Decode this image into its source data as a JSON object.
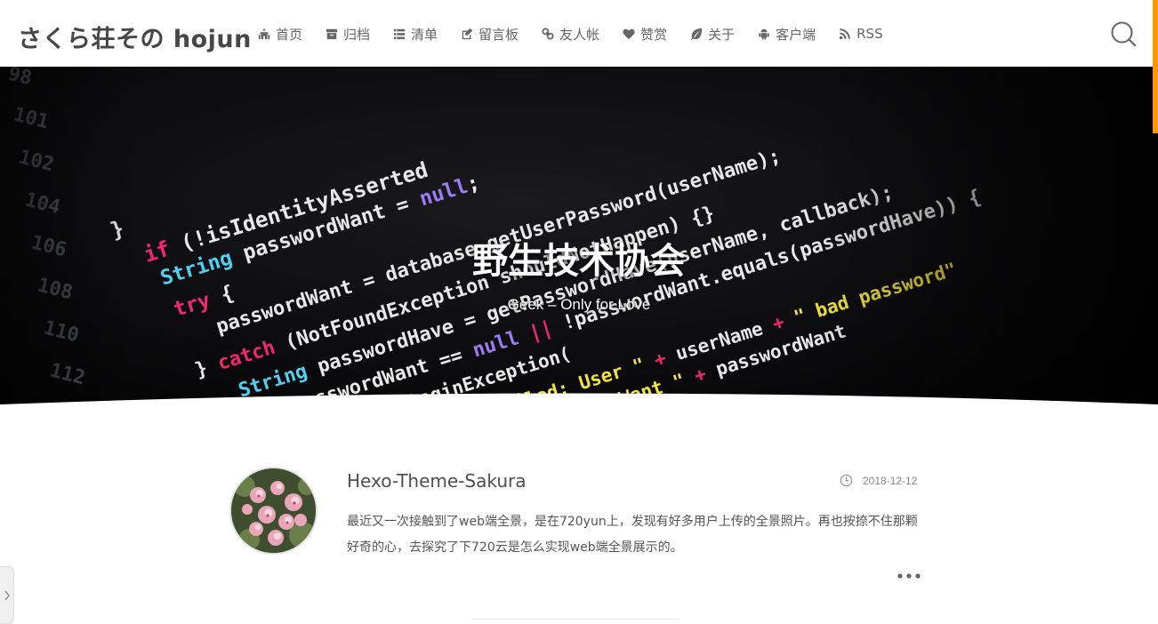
{
  "header": {
    "site_title": "さくら荘その hojun",
    "nav": [
      {
        "label": "首页",
        "icon": "home-icon"
      },
      {
        "label": "归档",
        "icon": "archive-icon"
      },
      {
        "label": "清单",
        "icon": "list-icon"
      },
      {
        "label": "留言板",
        "icon": "edit-icon"
      },
      {
        "label": "友人帐",
        "icon": "link-icon"
      },
      {
        "label": "赞赏",
        "icon": "heart-icon"
      },
      {
        "label": "关于",
        "icon": "leaf-icon"
      },
      {
        "label": "客户端",
        "icon": "android-icon"
      },
      {
        "label": "RSS",
        "icon": "rss-icon"
      }
    ],
    "search_icon": "search-icon"
  },
  "hero": {
    "title": "野生技术协会",
    "subtitle": "Geek – Only for Love"
  },
  "post": {
    "title": "Hexo-Theme-Sakura",
    "date": "2018-12-12",
    "excerpt": "最近又一次接触到了web端全景，是在720yun上，发现有好多用户上传的全景照片。再也按捺不住那颗好奇的心，去探究了下720云是怎么实现web端全景展示的。"
  },
  "colors": {
    "accent": "#fe9600",
    "title": "#464646",
    "nav_text": "#666666"
  }
}
